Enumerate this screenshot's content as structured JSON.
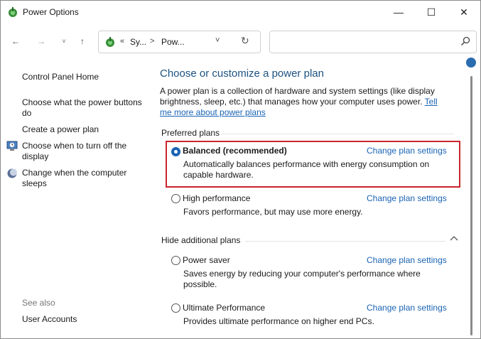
{
  "window": {
    "title": "Power Options",
    "controls": {
      "minimize": "—",
      "maximize": "☐",
      "close": "✕"
    }
  },
  "nav": {
    "back": "←",
    "forward": "→",
    "recent": "˅",
    "up": "↑",
    "address": {
      "chevron": "«",
      "seg1": "Sy...",
      "separator": ">",
      "seg2": "Pow...",
      "dropdown": "˅",
      "refresh": "↻"
    },
    "search_placeholder": ""
  },
  "sidebar": {
    "home": "Control Panel Home",
    "items": [
      {
        "label": "Choose what the power buttons do"
      },
      {
        "label": "Create a power plan"
      },
      {
        "label": "Choose when to turn off the display",
        "icon": "monitor-clock-icon"
      },
      {
        "label": "Change when the computer sleeps",
        "icon": "moon-icon"
      }
    ],
    "see_also": "See also",
    "see_also_items": [
      {
        "label": "User Accounts"
      }
    ]
  },
  "main": {
    "heading": "Choose or customize a power plan",
    "intro": "A power plan is a collection of hardware and system settings (like display brightness, sleep, etc.) that manages how your computer uses power. ",
    "intro_link": "Tell me more about power plans",
    "preferred_header": "Preferred plans",
    "additional_header": "Hide additional plans",
    "change_label": "Change plan settings",
    "plans": [
      {
        "name": "Balanced (recommended)",
        "desc": "Automatically balances performance with energy consumption on capable hardware.",
        "selected": true
      },
      {
        "name": "High performance",
        "desc": "Favors performance, but may use more energy.",
        "selected": false
      },
      {
        "name": "Power saver",
        "desc": "Saves energy by reducing your computer's performance where possible.",
        "selected": false
      },
      {
        "name": "Ultimate Performance",
        "desc": "Provides ultimate performance on higher end PCs.",
        "selected": false
      }
    ]
  },
  "colors": {
    "accent": "#1a64b4",
    "heading": "#1c5180",
    "highlight_border": "#c8262e"
  }
}
